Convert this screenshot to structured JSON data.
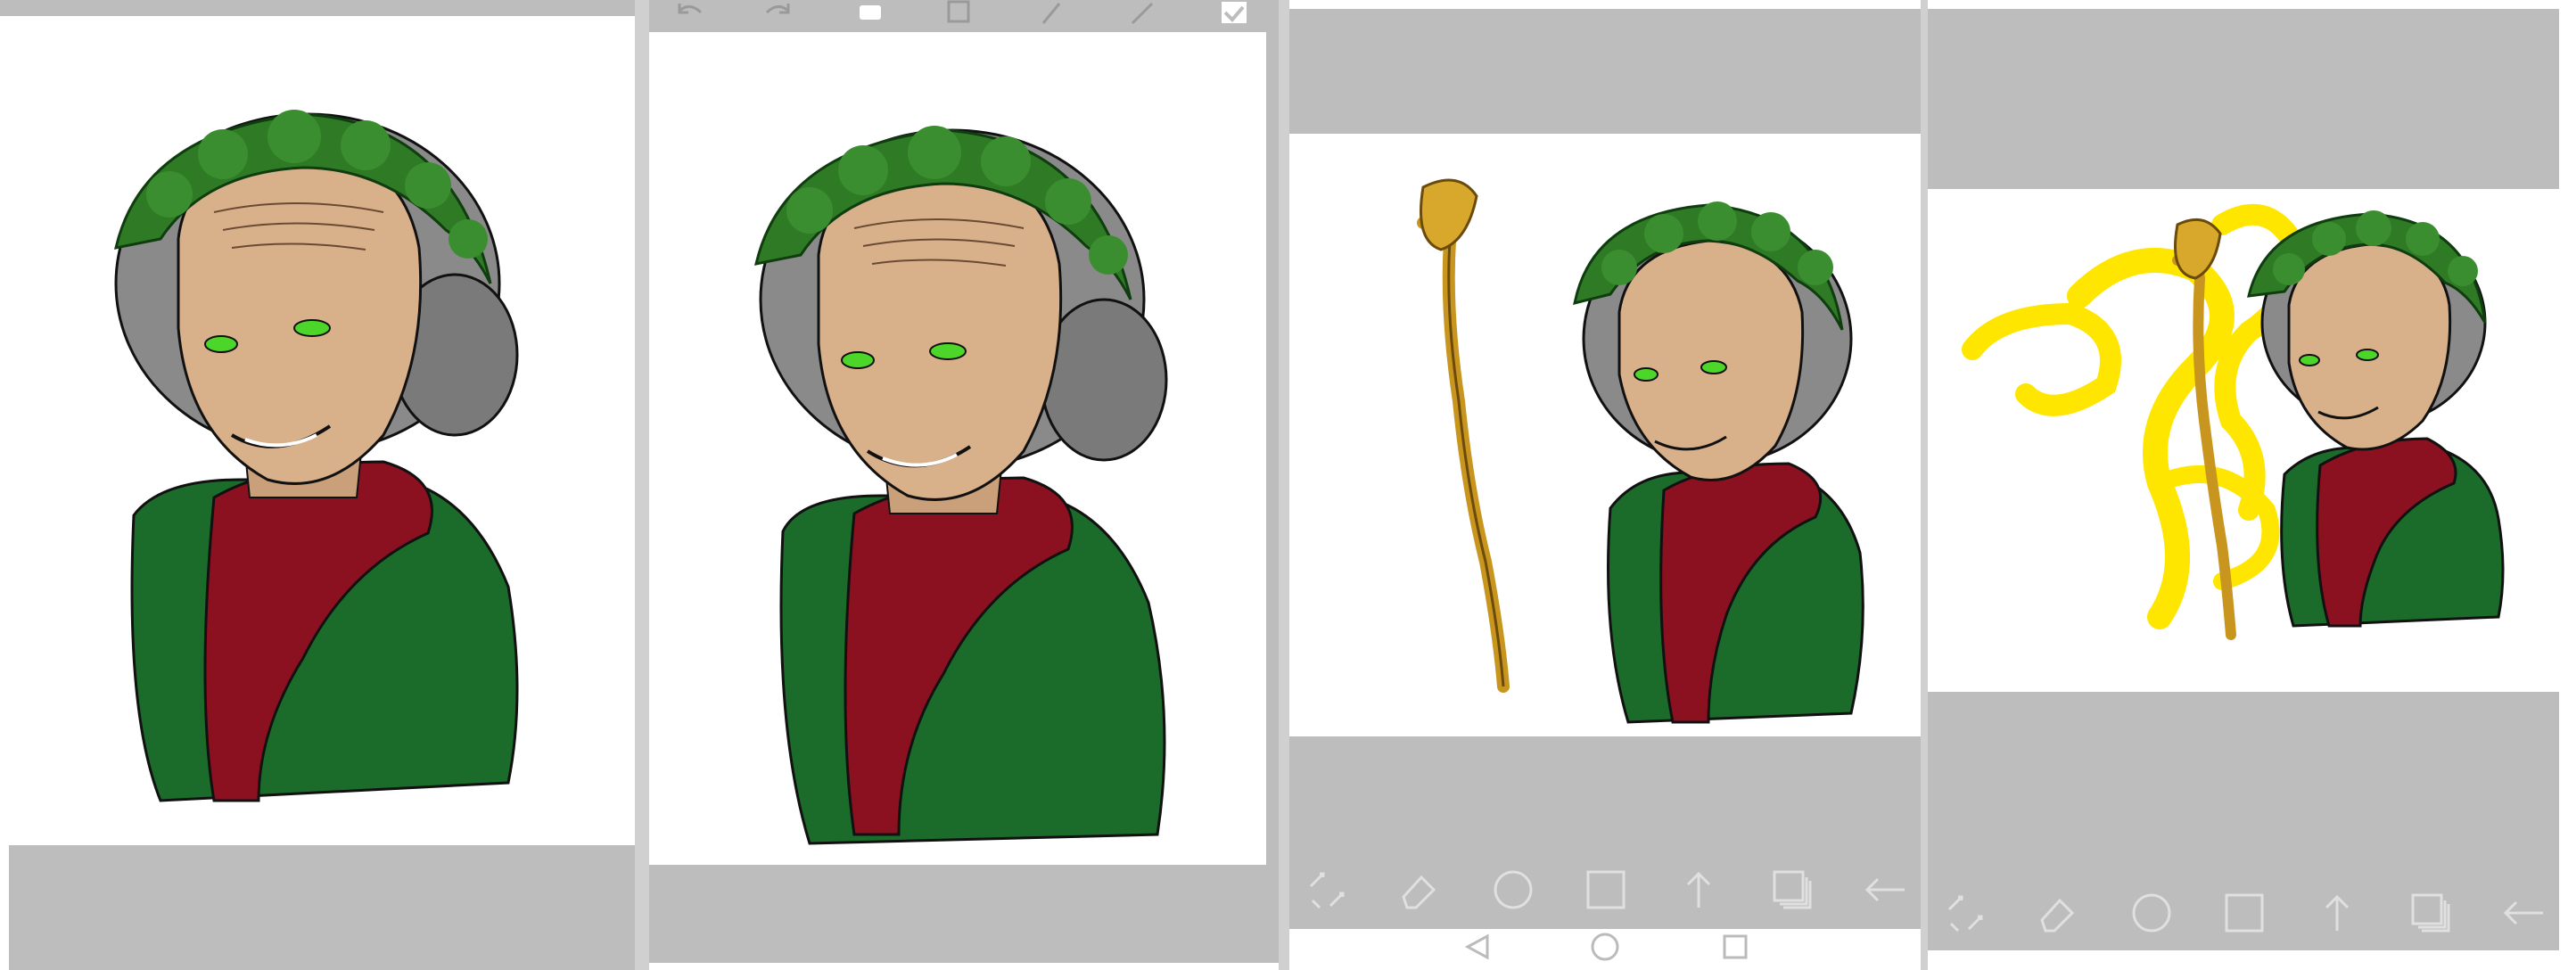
{
  "panels": [
    {
      "id": "p1",
      "top_toolbar": [
        "undo-icon",
        "redo-icon",
        "select-icon",
        "layers-icon",
        "brush-icon",
        "pen-icon",
        "confirm-icon"
      ],
      "bottom_toolbar": [
        "transform-icon",
        "eraser-icon",
        "circle-icon",
        "square-icon",
        "arrow-up-icon",
        "layers-icon",
        "back-arrow-icon"
      ]
    },
    {
      "id": "p2",
      "top_toolbar": [
        "undo-icon",
        "redo-icon",
        "select-icon",
        "layers-icon",
        "brush-icon",
        "pen-icon",
        "confirm-icon"
      ]
    },
    {
      "id": "p3",
      "bottom_toolbar": [
        "transform-icon",
        "eraser-icon",
        "circle-icon",
        "square-icon",
        "arrow-up-icon",
        "layers-icon",
        "back-arrow-icon"
      ],
      "system_nav": [
        "back-triangle-icon",
        "home-circle-icon",
        "recent-square-icon"
      ]
    },
    {
      "id": "p4",
      "bottom_toolbar": [
        "transform-icon",
        "eraser-icon",
        "circle-icon",
        "square-icon",
        "arrow-up-icon",
        "layers-icon",
        "back-arrow-icon"
      ]
    }
  ],
  "colors": {
    "workspace_gray": "#bdbdbd",
    "canvas_white": "#ffffff",
    "wreath_green": "#2f7a25",
    "hair_gray": "#8a8a8a",
    "skin": "#d8b08a",
    "robe_green": "#1b6b2a",
    "scarf_red": "#8b1020",
    "staff_gold": "#c8961e",
    "magic_yellow": "#ffe600",
    "eye_green": "#4cd62a",
    "icon_gray": "#9a9a9a"
  }
}
